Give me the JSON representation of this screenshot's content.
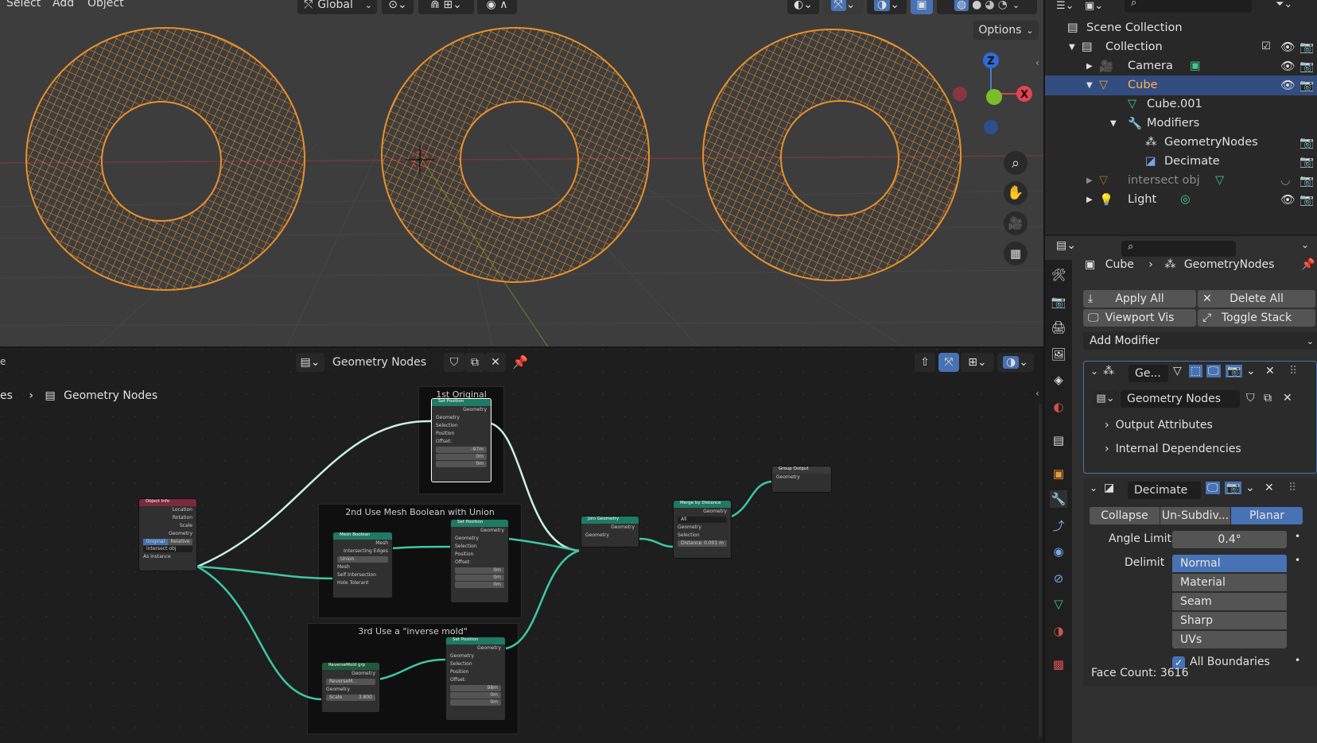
{
  "viewport": {
    "menu": [
      "Select",
      "Add",
      "Object"
    ],
    "orientation": "Global",
    "options_label": "Options",
    "gizmo": {
      "z": "Z",
      "x": "X"
    }
  },
  "node_editor": {
    "tree_name": "Geometry Nodes",
    "breadcrumb_root": "es",
    "breadcrumb_current": "Geometry Nodes",
    "frames": {
      "f1": "1st Original",
      "f2": "2nd Use Mesh Boolean with Union",
      "f3": "3rd Use a \"inverse mold\""
    },
    "nodes": {
      "object_info": {
        "title": "Object Info",
        "outputs": [
          "Location",
          "Rotation",
          "Scale",
          "Geometry"
        ],
        "mode_a": "Original",
        "mode_b": "Relative",
        "object": "intersect obj",
        "as_instance": "As Instance"
      },
      "set_pos1": {
        "title": "Set Position",
        "out": "Geometry",
        "inputs": [
          "Geometry",
          "Selection",
          "Position",
          "Offset:"
        ],
        "x": "-97m",
        "y": "0m",
        "z": "0m"
      },
      "mesh_bool": {
        "title": "Mesh Boolean",
        "outs": [
          "Mesh",
          "Intersecting Edges"
        ],
        "op": "Union",
        "ins": [
          "Mesh",
          "Self Intersection",
          "Hole Tolerant"
        ]
      },
      "set_pos2": {
        "title": "Set Position",
        "out": "Geometry",
        "inputs": [
          "Geometry",
          "Selection",
          "Position",
          "Offset:"
        ],
        "x": "0m",
        "y": "0m",
        "z": "0m"
      },
      "reverse_mold": {
        "title": "ReverseMold grp",
        "out": "Geometry",
        "group": "ReverseM...",
        "in": "Geometry",
        "scale_label": "Scale",
        "scale": "3.800"
      },
      "set_pos3": {
        "title": "Set Position",
        "out": "Geometry",
        "inputs": [
          "Geometry",
          "Selection",
          "Position",
          "Offset:"
        ],
        "x": "98m",
        "y": "0m",
        "z": "0m"
      },
      "join": {
        "title": "Join Geometry",
        "out": "Geometry",
        "in": "Geometry"
      },
      "merge": {
        "title": "Merge by Distance",
        "out": "Geometry",
        "mode": "All",
        "ins": [
          "Geometry",
          "Selection"
        ],
        "dist_label": "Distance",
        "dist": "0.001 m"
      },
      "group_out": {
        "title": "Group Output",
        "in": "Geometry"
      }
    }
  },
  "outliner": {
    "rows": [
      {
        "label": "Scene Collection",
        "indent": 0
      },
      {
        "label": "Collection",
        "indent": 1
      },
      {
        "label": "Camera",
        "indent": 2
      },
      {
        "label": "Cube",
        "indent": 2
      },
      {
        "label": "Cube.001",
        "indent": 3
      },
      {
        "label": "Modifiers",
        "indent": 3
      },
      {
        "label": "GeometryNodes",
        "indent": 4
      },
      {
        "label": "Decimate",
        "indent": 4
      },
      {
        "label": "intersect obj",
        "indent": 2
      },
      {
        "label": "Light",
        "indent": 2
      }
    ]
  },
  "properties": {
    "breadcrumb_object": "Cube",
    "breadcrumb_modifier": "GeometryNodes",
    "apply_all": "Apply All",
    "delete_all": "Delete All",
    "viewport_vis": "Viewport Vis",
    "toggle_stack": "Toggle Stack",
    "add_modifier": "Add Modifier",
    "gn_mod": {
      "name": "Ge...",
      "tree": "Geometry Nodes",
      "output_attrs": "Output Attributes",
      "internal_deps": "Internal Dependencies"
    },
    "decimate": {
      "name": "Decimate",
      "modes": [
        "Collapse",
        "Un-Subdiv...",
        "Planar"
      ],
      "angle_label": "Angle Limit",
      "angle": "0.4°",
      "delimit_label": "Delimit",
      "delimit_options": [
        "Normal",
        "Material",
        "Seam",
        "Sharp",
        "UVs"
      ],
      "all_boundaries": "All Boundaries",
      "face_count": "Face Count: 3616"
    }
  },
  "colors": {
    "accent": "#4772b3",
    "wire": "#e8902a",
    "node_teal": "#3ec9a0"
  }
}
